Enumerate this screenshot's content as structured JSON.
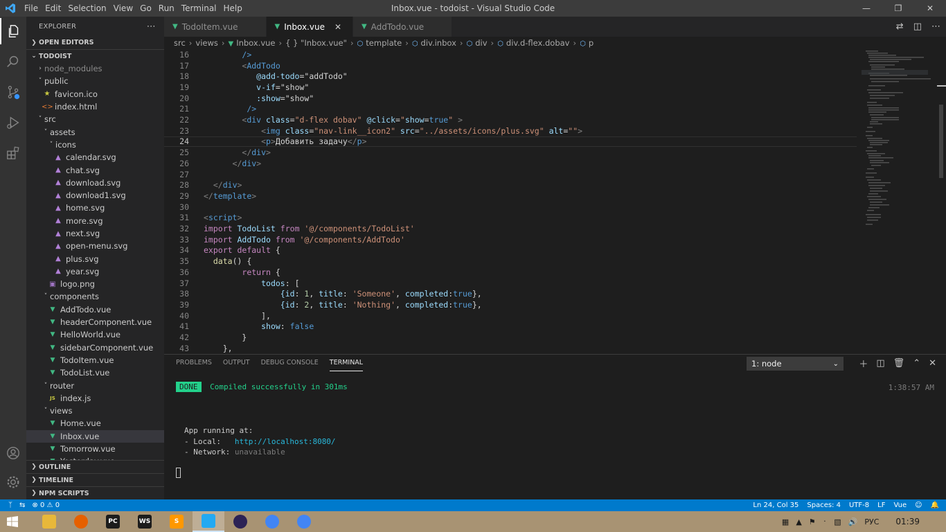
{
  "window": {
    "title": "Inbox.vue - todoist - Visual Studio Code",
    "menu": [
      "File",
      "Edit",
      "Selection",
      "View",
      "Go",
      "Run",
      "Terminal",
      "Help"
    ]
  },
  "explorer": {
    "header": "EXPLORER",
    "open_editors": "OPEN EDITORS",
    "project": "TODOIST",
    "tree": [
      {
        "label": "node_modules",
        "indent": 1,
        "type": "folder-closed",
        "muted": true
      },
      {
        "label": "public",
        "indent": 1,
        "type": "folder-open"
      },
      {
        "label": "favicon.ico",
        "indent": 2,
        "type": "star"
      },
      {
        "label": "index.html",
        "indent": 2,
        "type": "html"
      },
      {
        "label": "src",
        "indent": 1,
        "type": "folder-open"
      },
      {
        "label": "assets",
        "indent": 2,
        "type": "folder-open"
      },
      {
        "label": "icons",
        "indent": 3,
        "type": "folder-open"
      },
      {
        "label": "calendar.svg",
        "indent": 4,
        "type": "svg"
      },
      {
        "label": "chat.svg",
        "indent": 4,
        "type": "svg"
      },
      {
        "label": "download.svg",
        "indent": 4,
        "type": "svg"
      },
      {
        "label": "download1.svg",
        "indent": 4,
        "type": "svg"
      },
      {
        "label": "home.svg",
        "indent": 4,
        "type": "svg"
      },
      {
        "label": "more.svg",
        "indent": 4,
        "type": "svg"
      },
      {
        "label": "next.svg",
        "indent": 4,
        "type": "svg"
      },
      {
        "label": "open-menu.svg",
        "indent": 4,
        "type": "svg"
      },
      {
        "label": "plus.svg",
        "indent": 4,
        "type": "svg"
      },
      {
        "label": "year.svg",
        "indent": 4,
        "type": "svg"
      },
      {
        "label": "logo.png",
        "indent": 3,
        "type": "png"
      },
      {
        "label": "components",
        "indent": 2,
        "type": "folder-open"
      },
      {
        "label": "AddTodo.vue",
        "indent": 3,
        "type": "vue"
      },
      {
        "label": "headerComponent.vue",
        "indent": 3,
        "type": "vue"
      },
      {
        "label": "HelloWorld.vue",
        "indent": 3,
        "type": "vue"
      },
      {
        "label": "sidebarComponent.vue",
        "indent": 3,
        "type": "vue"
      },
      {
        "label": "TodoItem.vue",
        "indent": 3,
        "type": "vue"
      },
      {
        "label": "TodoList.vue",
        "indent": 3,
        "type": "vue"
      },
      {
        "label": "router",
        "indent": 2,
        "type": "folder-open"
      },
      {
        "label": "index.js",
        "indent": 3,
        "type": "js"
      },
      {
        "label": "views",
        "indent": 2,
        "type": "folder-open"
      },
      {
        "label": "Home.vue",
        "indent": 3,
        "type": "vue"
      },
      {
        "label": "Inbox.vue",
        "indent": 3,
        "type": "vue",
        "selected": true
      },
      {
        "label": "Tomorrow.vue",
        "indent": 3,
        "type": "vue"
      },
      {
        "label": "Yesterday.vue",
        "indent": 3,
        "type": "vue"
      }
    ],
    "outline": "OUTLINE",
    "timeline": "TIMELINE",
    "npm_scripts": "NPM SCRIPTS"
  },
  "tabs": [
    {
      "label": "TodoItem.vue",
      "active": false
    },
    {
      "label": "Inbox.vue",
      "active": true
    },
    {
      "label": "AddTodo.vue",
      "active": false
    }
  ],
  "breadcrumb": [
    "src",
    "views",
    "Inbox.vue",
    "{ } \"Inbox.vue\"",
    "template",
    "div.inbox",
    "div",
    "div.d-flex.dobav",
    "p"
  ],
  "editor": {
    "current_line": 24,
    "lines": [
      {
        "n": 16,
        "t": [
          [
            "        ",
            ""
          ],
          [
            "/>",
            "c-tag"
          ]
        ]
      },
      {
        "n": 17,
        "t": [
          [
            "        ",
            ""
          ],
          [
            "<",
            "c-punct"
          ],
          [
            "AddTodo",
            "c-tag"
          ]
        ]
      },
      {
        "n": 18,
        "t": [
          [
            "           ",
            ""
          ],
          [
            "@add-todo",
            "c-attr"
          ],
          [
            "=",
            "c-text"
          ],
          [
            "\"addTodo\"",
            "c-text"
          ]
        ]
      },
      {
        "n": 19,
        "t": [
          [
            "           ",
            ""
          ],
          [
            "v-if",
            "c-attr"
          ],
          [
            "=",
            "c-text"
          ],
          [
            "\"show\"",
            "c-text"
          ]
        ]
      },
      {
        "n": 20,
        "t": [
          [
            "           ",
            ""
          ],
          [
            ":show",
            "c-attr"
          ],
          [
            "=",
            "c-text"
          ],
          [
            "\"show\"",
            "c-text"
          ]
        ]
      },
      {
        "n": 21,
        "t": [
          [
            "         ",
            ""
          ],
          [
            "/>",
            "c-tag"
          ]
        ]
      },
      {
        "n": 22,
        "t": [
          [
            "        ",
            ""
          ],
          [
            "<",
            "c-punct"
          ],
          [
            "div",
            "c-tag"
          ],
          [
            " class",
            "c-attr"
          ],
          [
            "=",
            "c-text"
          ],
          [
            "\"d-flex dobav\"",
            "c-str"
          ],
          [
            " @click",
            "c-attr"
          ],
          [
            "=",
            "c-text"
          ],
          [
            "\"",
            "c-str"
          ],
          [
            "show",
            "c-attr"
          ],
          [
            "=",
            "c-text"
          ],
          [
            "true",
            "c-bool"
          ],
          [
            "\"",
            "c-str"
          ],
          [
            " >",
            "c-punct"
          ]
        ]
      },
      {
        "n": 23,
        "t": [
          [
            "            ",
            ""
          ],
          [
            "<",
            "c-punct"
          ],
          [
            "img",
            "c-tag"
          ],
          [
            " class",
            "c-attr"
          ],
          [
            "=",
            "c-text"
          ],
          [
            "\"nav-link__icon2\"",
            "c-str"
          ],
          [
            " src",
            "c-attr"
          ],
          [
            "=",
            "c-text"
          ],
          [
            "\"../assets/icons/plus.svg\"",
            "c-str"
          ],
          [
            " alt",
            "c-attr"
          ],
          [
            "=",
            "c-text"
          ],
          [
            "\"\"",
            "c-str"
          ],
          [
            ">",
            "c-punct"
          ]
        ]
      },
      {
        "n": 24,
        "t": [
          [
            "            ",
            ""
          ],
          [
            "<",
            "c-punct"
          ],
          [
            "p",
            "c-tag"
          ],
          [
            ">",
            "c-punct"
          ],
          [
            "Добавить задачу",
            "c-text"
          ],
          [
            "</",
            "c-punct"
          ],
          [
            "p",
            "c-tag"
          ],
          [
            ">",
            "c-punct"
          ]
        ]
      },
      {
        "n": 25,
        "t": [
          [
            "        ",
            ""
          ],
          [
            "</",
            "c-punct"
          ],
          [
            "div",
            "c-tag"
          ],
          [
            ">",
            "c-punct"
          ]
        ]
      },
      {
        "n": 26,
        "t": [
          [
            "      ",
            ""
          ],
          [
            "</",
            "c-punct"
          ],
          [
            "div",
            "c-tag"
          ],
          [
            ">",
            "c-punct"
          ]
        ]
      },
      {
        "n": 27,
        "t": [
          [
            "",
            ""
          ]
        ]
      },
      {
        "n": 28,
        "t": [
          [
            "  ",
            ""
          ],
          [
            "</",
            "c-punct"
          ],
          [
            "div",
            "c-tag"
          ],
          [
            ">",
            "c-punct"
          ]
        ]
      },
      {
        "n": 29,
        "t": [
          [
            "</",
            "c-punct"
          ],
          [
            "template",
            "c-tag"
          ],
          [
            ">",
            "c-punct"
          ]
        ]
      },
      {
        "n": 30,
        "t": [
          [
            "",
            ""
          ]
        ]
      },
      {
        "n": 31,
        "t": [
          [
            "<",
            "c-punct"
          ],
          [
            "script",
            "c-tag"
          ],
          [
            ">",
            "c-punct"
          ]
        ]
      },
      {
        "n": 32,
        "t": [
          [
            "import",
            "c-kw"
          ],
          [
            " TodoList ",
            "c-attr"
          ],
          [
            "from",
            "c-kw"
          ],
          [
            " '@/components/TodoList'",
            "c-str"
          ]
        ]
      },
      {
        "n": 33,
        "t": [
          [
            "import",
            "c-kw"
          ],
          [
            " AddTodo ",
            "c-attr"
          ],
          [
            "from",
            "c-kw"
          ],
          [
            " '@/components/AddTodo'",
            "c-str"
          ]
        ]
      },
      {
        "n": 34,
        "t": [
          [
            "export",
            "c-kw"
          ],
          [
            " ",
            ""
          ],
          [
            "default",
            "c-kw"
          ],
          [
            " {",
            "c-text"
          ]
        ]
      },
      {
        "n": 35,
        "t": [
          [
            "  ",
            ""
          ],
          [
            "data",
            "c-fn"
          ],
          [
            "() {",
            "c-text"
          ]
        ]
      },
      {
        "n": 36,
        "t": [
          [
            "        ",
            ""
          ],
          [
            "return",
            "c-kw"
          ],
          [
            " {",
            "c-text"
          ]
        ]
      },
      {
        "n": 37,
        "t": [
          [
            "            ",
            ""
          ],
          [
            "todos",
            "c-attr"
          ],
          [
            ": [",
            "c-text"
          ]
        ]
      },
      {
        "n": 38,
        "t": [
          [
            "                ",
            ""
          ],
          [
            "{id",
            "c-attr"
          ],
          [
            ": ",
            "c-text"
          ],
          [
            "1",
            "c-num"
          ],
          [
            ", ",
            "c-text"
          ],
          [
            "title",
            "c-attr"
          ],
          [
            ": ",
            "c-text"
          ],
          [
            "'Someone'",
            "c-str"
          ],
          [
            ", ",
            "c-text"
          ],
          [
            "completed",
            "c-attr"
          ],
          [
            ":",
            "c-text"
          ],
          [
            "true",
            "c-bool"
          ],
          [
            "},",
            "c-text"
          ]
        ]
      },
      {
        "n": 39,
        "t": [
          [
            "                ",
            ""
          ],
          [
            "{id",
            "c-attr"
          ],
          [
            ": ",
            "c-text"
          ],
          [
            "2",
            "c-num"
          ],
          [
            ", ",
            "c-text"
          ],
          [
            "title",
            "c-attr"
          ],
          [
            ": ",
            "c-text"
          ],
          [
            "'Nothing'",
            "c-str"
          ],
          [
            ", ",
            "c-text"
          ],
          [
            "completed",
            "c-attr"
          ],
          [
            ":",
            "c-text"
          ],
          [
            "true",
            "c-bool"
          ],
          [
            "},",
            "c-text"
          ]
        ]
      },
      {
        "n": 40,
        "t": [
          [
            "            ",
            ""
          ],
          [
            "],",
            "c-text"
          ]
        ]
      },
      {
        "n": 41,
        "t": [
          [
            "            ",
            ""
          ],
          [
            "show",
            "c-attr"
          ],
          [
            ": ",
            "c-text"
          ],
          [
            "false",
            "c-bool"
          ]
        ]
      },
      {
        "n": 42,
        "t": [
          [
            "        ",
            ""
          ],
          [
            "}",
            "c-text"
          ]
        ]
      },
      {
        "n": 43,
        "t": [
          [
            "    ",
            ""
          ],
          [
            "},",
            "c-text"
          ]
        ]
      }
    ]
  },
  "panel": {
    "tabs": [
      "PROBLEMS",
      "OUTPUT",
      "DEBUG CONSOLE",
      "TERMINAL"
    ],
    "active_tab": "TERMINAL",
    "terminal_select": "1: node",
    "done_badge": "DONE",
    "compiled_msg": "Compiled successfully in 301ms",
    "time": "1:38:57 AM",
    "app_running": "App running at:",
    "local_label": "- Local:   ",
    "local_url": "http://localhost:8080/",
    "network_label": "- Network: ",
    "network_value": "unavailable"
  },
  "status": {
    "errors": "0",
    "warnings": "0",
    "position": "Ln 24, Col 35",
    "spaces": "Spaces: 4",
    "encoding": "UTF-8",
    "eol": "LF",
    "language": "Vue"
  },
  "taskbar": {
    "apps": [
      {
        "icon": "file-explorer-icon",
        "color": "#e8b83a",
        "label": ""
      },
      {
        "icon": "firefox-icon",
        "color": "#e66000",
        "label": ""
      },
      {
        "icon": "pycharm-icon",
        "color": "#1c1c1c",
        "label": "PC"
      },
      {
        "icon": "webstorm-icon",
        "color": "#1c1c1c",
        "label": "WS"
      },
      {
        "icon": "sublime-icon",
        "color": "#ff9800",
        "label": "S"
      },
      {
        "icon": "vscode-icon",
        "color": "#23a9f2",
        "label": "",
        "active": true
      },
      {
        "icon": "eclipse-icon",
        "color": "#2c2255",
        "label": ""
      },
      {
        "icon": "chrome-icon",
        "color": "#4285f4",
        "label": ""
      },
      {
        "icon": "chrome-icon-2",
        "color": "#4285f4",
        "label": ""
      }
    ],
    "language": "РУС",
    "clock": "01:39"
  }
}
